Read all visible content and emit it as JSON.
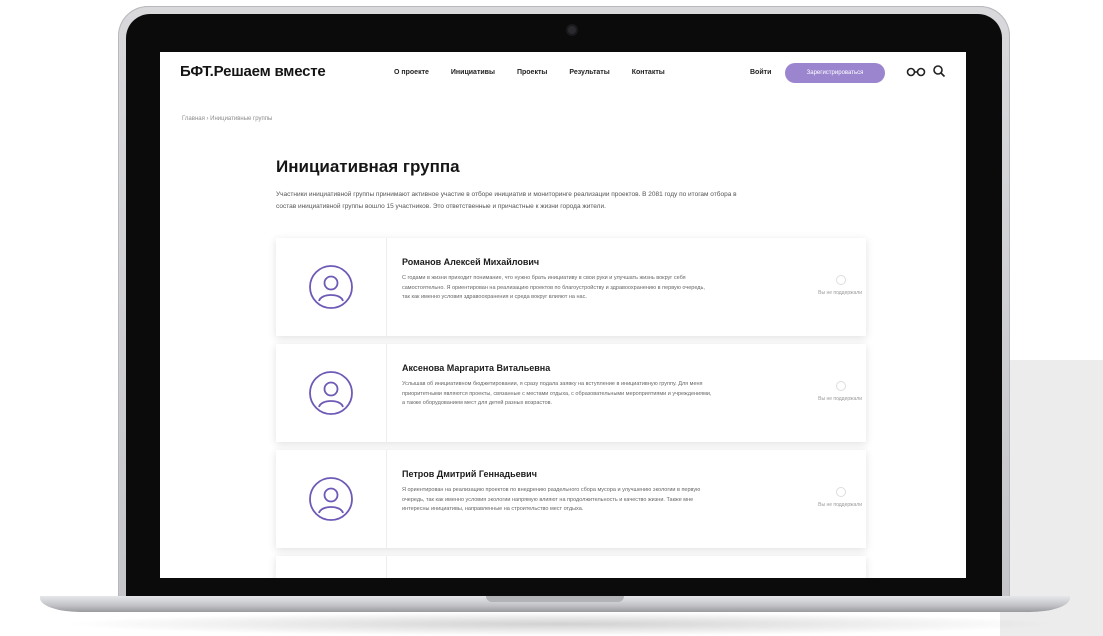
{
  "site": {
    "logo": "БФТ.Решаем вместе",
    "nav": [
      "О проекте",
      "Инициативы",
      "Проекты",
      "Результаты",
      "Контакты"
    ],
    "login": "Войти",
    "register": "Зарегистрироваться"
  },
  "breadcrumb": "Главная  ›  Инициативные группы",
  "page": {
    "title": "Инициативная группа",
    "intro": "Участники инициативной группы принимают активное участие в отборе инициатив и мониторинге реализации проектов. В 2081 году по итогам отбора в состав инициативной группы вошло 15 участников. Это ответственные и причастные к жизни города жители."
  },
  "members": [
    {
      "name": "Романов Алексей Михайлович",
      "text": "С годами в жизни приходит понимание, что нужно брать инициативу в свои руки и улучшать жизнь вокруг себя самостоятельно. Я ориентирован на реализацию проектов по благоустройству и здравоохранению в первую очередь, так как именно условия здравоохранения и среда вокруг влияют на нас.",
      "support": "Вы не поддержали"
    },
    {
      "name": "Аксенова Маргарита Витальевна",
      "text": "Услышав об инициативном бюджетировании, я сразу подала заявку на вступление в инициативную группу. Для меня приоритетными являются проекты, связанные с местами отдыха, с образовательными мероприятиями и учреждениями, а также оборудованием мест для детей разных возрастов.",
      "support": "Вы не поддержали"
    },
    {
      "name": "Петров Дмитрий Геннадьевич",
      "text": "Я ориентирован на реализацию проектов по внедрению раздельного сбора мусора и улучшению экологии в первую очередь, так как именно условия экологии напрямую влияют на продолжительность и качество жизни. Также мне интересны инициативы, направленные на строительство мест отдыха.",
      "support": "Вы не поддержали"
    }
  ],
  "colors": {
    "accent": "#9b85cf",
    "avatar_stroke": "#6e5ab6"
  },
  "icons": [
    "glasses-icon",
    "search-icon",
    "user-avatar-icon",
    "support-heart-icon"
  ]
}
